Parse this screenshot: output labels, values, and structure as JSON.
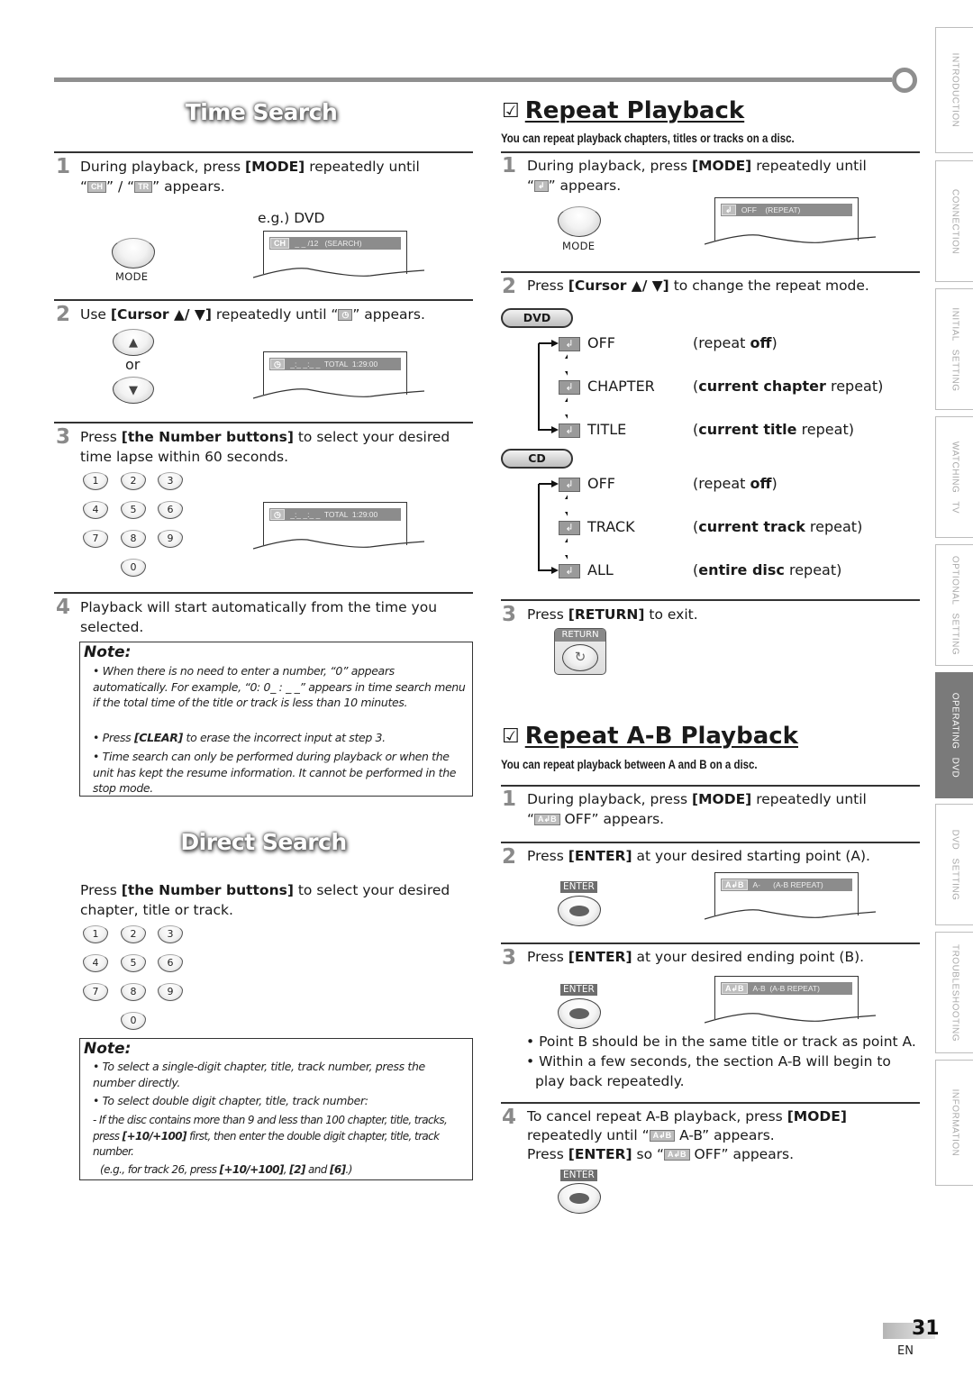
{
  "page": {
    "number": "31",
    "language": "EN"
  },
  "side_tabs": [
    {
      "label": "INTRODUCTION",
      "active": false
    },
    {
      "label": "CONNECTION",
      "active": false
    },
    {
      "label": "INITIAL SETTING",
      "active": false
    },
    {
      "label": "WATCHING TV",
      "active": false
    },
    {
      "label": "OPTIONAL SETTING",
      "active": false
    },
    {
      "label": "OPERATING DVD",
      "active": true
    },
    {
      "label": "DVD SETTING",
      "active": false
    },
    {
      "label": "TROUBLESHOOTING",
      "active": false
    },
    {
      "label": "INFORMATION",
      "active": false
    }
  ],
  "time_search": {
    "title": "Time Search",
    "step1": {
      "num": "1",
      "text_a": "During playback, press ",
      "key": "[MODE]",
      "text_b": " repeatedly until",
      "line2_a": "“",
      "chip_ch": "CH",
      "line2_b": "” / “",
      "chip_tr": "TR",
      "line2_c": "” appears.",
      "example_label": "e.g.) DVD",
      "button_caption": "MODE",
      "osd_chip": "CH",
      "osd_text": " _ _ /12   (SEARCH)"
    },
    "step2": {
      "num": "2",
      "text_a": "Use ",
      "key": "[Cursor ▲/ ▼]",
      "text_b": " repeatedly until “",
      "chip_clock": "◷",
      "text_c": "” appears.",
      "up_glyph": "▲",
      "down_glyph": "▼",
      "or_label": "or",
      "osd_chip": "◷",
      "osd_text": " _:_ _:_ _  TOTAL  1:29:00"
    },
    "step3": {
      "num": "3",
      "text_a": "Press ",
      "key": "[the Number buttons]",
      "text_b": " to select your desired",
      "line2": "time lapse within 60 seconds.",
      "keypad": [
        "1",
        "2",
        "3",
        "4",
        "5",
        "6",
        "7",
        "8",
        "9",
        "0"
      ],
      "osd_chip": "◷",
      "osd_text": " _:_ _:_ _  TOTAL  1:29:00"
    },
    "step4": {
      "num": "4",
      "line1": "Playback will start automatically from the time you",
      "line2": "selected."
    },
    "note": {
      "title": "Note:",
      "items": [
        "When there is no need to enter a number, “0” appears automatically. For example, “0: 0_ : _ _” appears in time search menu if the total time of the title or track is less than 10 minutes.",
        "to erase the incorrect input at step 3.",
        "Time search can only be performed during playback or when the unit has kept the resume information. It cannot be performed in the stop mode."
      ],
      "item2_prefix": "Press ",
      "item2_key": "[CLEAR]"
    }
  },
  "direct_search": {
    "title": "Direct Search",
    "text_a": "Press ",
    "key": "[the Number buttons]",
    "text_b": " to select your desired",
    "line2": "chapter, title or track.",
    "keypad": [
      "1",
      "2",
      "3",
      "4",
      "5",
      "6",
      "7",
      "8",
      "9",
      "0"
    ],
    "note": {
      "title": "Note:",
      "item1": "To select a single-digit chapter, title, track number, press the number directly.",
      "item2": "To select double digit chapter, title, track number:",
      "item3_a": "If the disc contains more than 9 and less than 100 chapter, title, tracks, press ",
      "item3_key": "[+10/+100]",
      "item3_b": " first, then enter the double digit chapter, title, track number.",
      "example_a": "(e.g., for track 26, press ",
      "example_k1": "[+10/+100]",
      "example_sep": ", ",
      "example_k2": "[2]",
      "example_and": " and ",
      "example_k3": "[6]",
      "example_end": ".)"
    }
  },
  "repeat_playback": {
    "checkbox": "☑",
    "title": "Repeat Playback",
    "subtitle": "You can repeat playback chapters, titles or tracks on a disc.",
    "step1": {
      "num": "1",
      "text_a": "During playback, press ",
      "key": "[MODE]",
      "text_b": " repeatedly until",
      "line2_a": "“",
      "chip": "↲",
      "line2_b": "” appears.",
      "button_caption": "MODE",
      "osd_chip": "↲",
      "osd_text": " OFF    (REPEAT)"
    },
    "step2": {
      "num": "2",
      "text_a": "Press ",
      "key": "[Cursor ▲/ ▼]",
      "text_b": " to change the repeat mode."
    },
    "dvd": {
      "pill": "DVD",
      "modes": [
        {
          "label": "OFF",
          "desc_a": "(repeat ",
          "desc_b": "off",
          "desc_c": ")"
        },
        {
          "label": "CHAPTER",
          "desc_a": "(",
          "desc_b": "current chapter",
          "desc_c": " repeat)"
        },
        {
          "label": "TITLE",
          "desc_a": "(",
          "desc_b": "current title",
          "desc_c": " repeat)"
        }
      ]
    },
    "cd": {
      "pill": "CD",
      "modes": [
        {
          "label": "OFF",
          "desc_a": "(repeat ",
          "desc_b": "off",
          "desc_c": ")"
        },
        {
          "label": "TRACK",
          "desc_a": "(",
          "desc_b": "current track",
          "desc_c": " repeat)"
        },
        {
          "label": "ALL",
          "desc_a": "(",
          "desc_b": "entire disc",
          "desc_c": " repeat)"
        }
      ]
    },
    "repeat_icon": "↲",
    "step3": {
      "num": "3",
      "text_a": "Press ",
      "key": "[RETURN]",
      "text_b": " to exit.",
      "button_caption": "RETURN",
      "button_glyph": "↻"
    }
  },
  "repeat_ab": {
    "checkbox": "☑",
    "title": "Repeat A-B Playback",
    "subtitle": "You can repeat playback between A and B on a disc.",
    "ab_chip": "A↲B",
    "step1": {
      "num": "1",
      "text_a": "During playback, press ",
      "key": "[MODE]",
      "text_b": " repeatedly until",
      "line2_a": "“",
      "line2_b": " OFF” appears."
    },
    "step2": {
      "num": "2",
      "text_a": "Press ",
      "key": "[ENTER]",
      "text_b": " at your desired starting point (A).",
      "button_caption": "ENTER",
      "osd_text": " A-      (A-B REPEAT)"
    },
    "step3": {
      "num": "3",
      "text_a": "Press ",
      "key": "[ENTER]",
      "text_b": " at your desired ending point (B).",
      "button_caption": "ENTER",
      "osd_text": " A-B  (A-B REPEAT)",
      "bullets": [
        "Point B should be in the same title or track as point A.",
        "Within a few seconds, the section A-B will begin to",
        "play back repeatedly."
      ]
    },
    "step4": {
      "num": "4",
      "text_a": "To cancel repeat A-B playback, press ",
      "key": "[MODE]",
      "line2_a": "repeatedly until “",
      "line2_b": " A-B” appears.",
      "line3_a": "Press ",
      "line3_key": "[ENTER]",
      "line3_b": " so “",
      "line3_c": " OFF” appears.",
      "button_caption": "ENTER"
    }
  }
}
